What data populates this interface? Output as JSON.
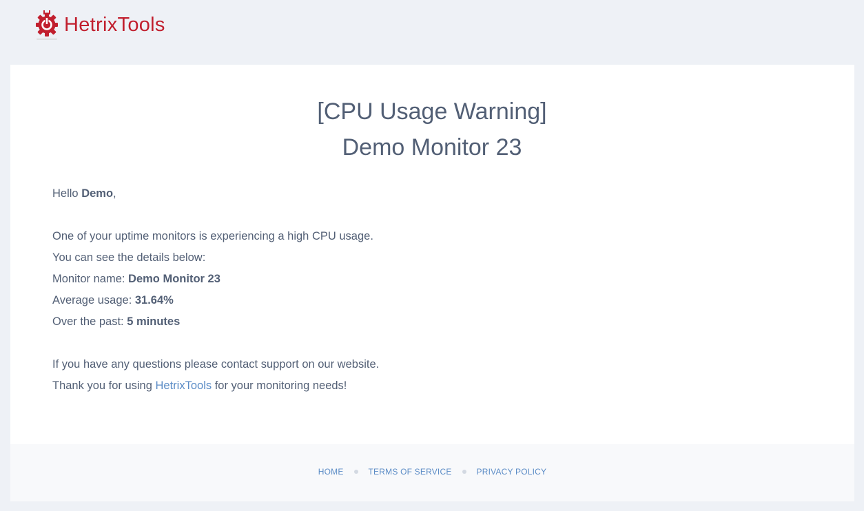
{
  "brand": {
    "name": "HetrixTools",
    "color": "#c11f2e",
    "icon": "gear-power-logo-icon"
  },
  "title": {
    "line1": "[CPU Usage Warning]",
    "line2": "Demo Monitor 23"
  },
  "greeting": {
    "prefix": "Hello ",
    "name": "Demo",
    "suffix": ","
  },
  "message": {
    "intro": "One of your uptime monitors is experiencing a high CPU usage.",
    "details_intro": "You can see the details below:",
    "monitor_label": "Monitor name: ",
    "monitor_value": "Demo Monitor 23",
    "usage_label": "Average usage: ",
    "usage_value": "31.64%",
    "period_label": "Over the past: ",
    "period_value": "5 minutes",
    "questions": "If you have any questions please contact support on our website.",
    "thanks_prefix": "Thank you for using ",
    "thanks_link": "HetrixTools",
    "thanks_suffix": " for your monitoring needs!"
  },
  "footer": {
    "links": [
      "HOME",
      "TERMS OF SERVICE",
      "PRIVACY POLICY"
    ]
  },
  "colors": {
    "text": "#525f75",
    "link": "#5b8cc6",
    "page_bg": "#eef1f6",
    "card_bg": "#ffffff",
    "footer_bg": "#f8f9fb"
  }
}
